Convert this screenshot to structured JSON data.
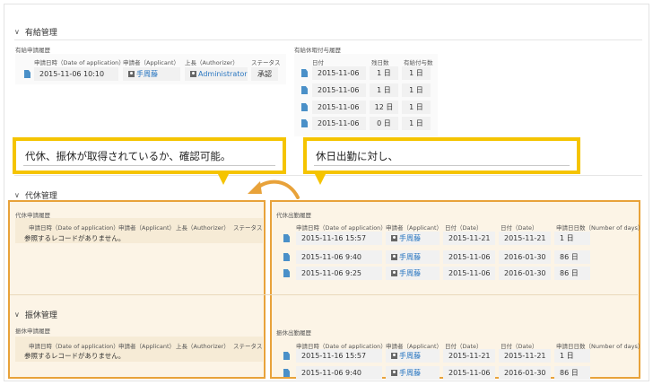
{
  "paid_leave": {
    "title": "有給管理",
    "app_history_title": "有給申請履歴",
    "app_headers": [
      "申請日時（Date of application）",
      "申請者（Applicant）",
      "上長（Authorizer）",
      "ステータス"
    ],
    "app_row": {
      "date": "2015-11-06 10:10",
      "applicant": "手周藤",
      "authorizer": "Administrator",
      "status": "承認"
    },
    "grant_history_title": "有給休暇付与履歴",
    "grant_headers": [
      "日付",
      "残日数",
      "有給付与数"
    ],
    "grant_rows": [
      {
        "date": "2015-11-06",
        "remaining": "1 日",
        "granted": "1 日"
      },
      {
        "date": "2015-11-06",
        "remaining": "1 日",
        "granted": "1 日"
      },
      {
        "date": "2015-11-06",
        "remaining": "12 日",
        "granted": "1 日"
      },
      {
        "date": "2015-11-06",
        "remaining": "0 日",
        "granted": "1 日"
      }
    ]
  },
  "comp_leave": {
    "title": "代休管理",
    "app_history_title": "代休申請履歴",
    "app_headers": [
      "申請日時（Date of application）",
      "申請者（Applicant）",
      "上長（Authorizer）",
      "ステータス"
    ],
    "empty_message": "参照するレコードがありません。",
    "work_history_title": "代休出勤履歴",
    "work_headers": [
      "申請日時（Date of application）",
      "申請者（Applicant）",
      "日付（Date）",
      "日付（Date）",
      "申請日日数（Number of days）"
    ],
    "work_rows": [
      {
        "date": "2015-11-16 15:57",
        "applicant": "手周藤",
        "d1": "2015-11-21",
        "d2": "2015-11-21",
        "days": "1 日"
      },
      {
        "date": "2015-11-06 9:40",
        "applicant": "手周藤",
        "d1": "2015-11-06",
        "d2": "2016-01-30",
        "days": "86 日"
      },
      {
        "date": "2015-11-06 9:25",
        "applicant": "手周藤",
        "d1": "2015-11-06",
        "d2": "2016-01-30",
        "days": "86 日"
      }
    ]
  },
  "transfer_leave": {
    "title": "振休管理",
    "app_history_title": "振休申請履歴",
    "app_headers": [
      "申請日時（Date of application）",
      "申請者（Applicant）",
      "上長（Authorizer）",
      "ステータス"
    ],
    "empty_message": "参照するレコードがありません。",
    "work_history_title": "振休出勤履歴",
    "work_headers": [
      "申請日時（Date of application）",
      "申請者（Applicant）",
      "日付（Date）",
      "日付（Date）",
      "申請日日数（Number of days）"
    ],
    "work_rows": [
      {
        "date": "2015-11-16 15:57",
        "applicant": "手周藤",
        "d1": "2015-11-21",
        "d2": "2015-11-21",
        "days": "1 日"
      },
      {
        "date": "2015-11-06 9:40",
        "applicant": "手周藤",
        "d1": "2015-11-06",
        "d2": "2016-01-30",
        "days": "86 日"
      }
    ]
  },
  "callouts": {
    "left": "代休、振休が取得されているか、確認可能。",
    "right": "休日出勤に対し、"
  },
  "colors": {
    "accent_orange": "#e8a23a",
    "callout_yellow": "#f5c400",
    "link_blue": "#2a77c1",
    "doc_icon_blue": "#4a90c8"
  }
}
